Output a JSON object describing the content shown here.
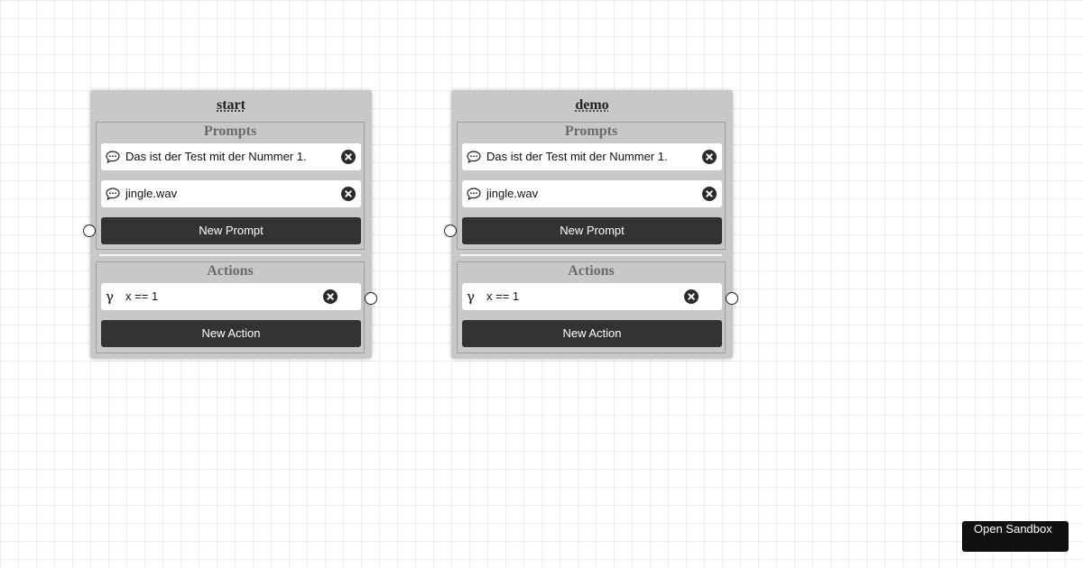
{
  "nodes": [
    {
      "title": "start",
      "prompts_title": "Prompts",
      "prompts": [
        {
          "icon": "speech-bubble-icon",
          "text": "Das ist der Test mit der Nummer 1."
        },
        {
          "icon": "speech-bubble-icon",
          "text": "jingle.wav"
        }
      ],
      "new_prompt_label": "New Prompt",
      "actions_title": "Actions",
      "actions": [
        {
          "icon": "gamma-icon",
          "symbol": "γ",
          "text": "x == 1"
        }
      ],
      "new_action_label": "New Action"
    },
    {
      "title": "demo",
      "prompts_title": "Prompts",
      "prompts": [
        {
          "icon": "speech-bubble-icon",
          "text": "Das ist der Test mit der Nummer 1."
        },
        {
          "icon": "speech-bubble-icon",
          "text": "jingle.wav"
        }
      ],
      "new_prompt_label": "New Prompt",
      "actions_title": "Actions",
      "actions": [
        {
          "icon": "gamma-icon",
          "symbol": "γ",
          "text": "x == 1"
        }
      ],
      "new_action_label": "New Action"
    }
  ],
  "sandbox_button": {
    "label": "Open Sandbox"
  },
  "colors": {
    "node_bg": "#c8c8c8",
    "button_bg": "#333333",
    "sandbox_bg": "#111111",
    "grid": "#ececec"
  }
}
